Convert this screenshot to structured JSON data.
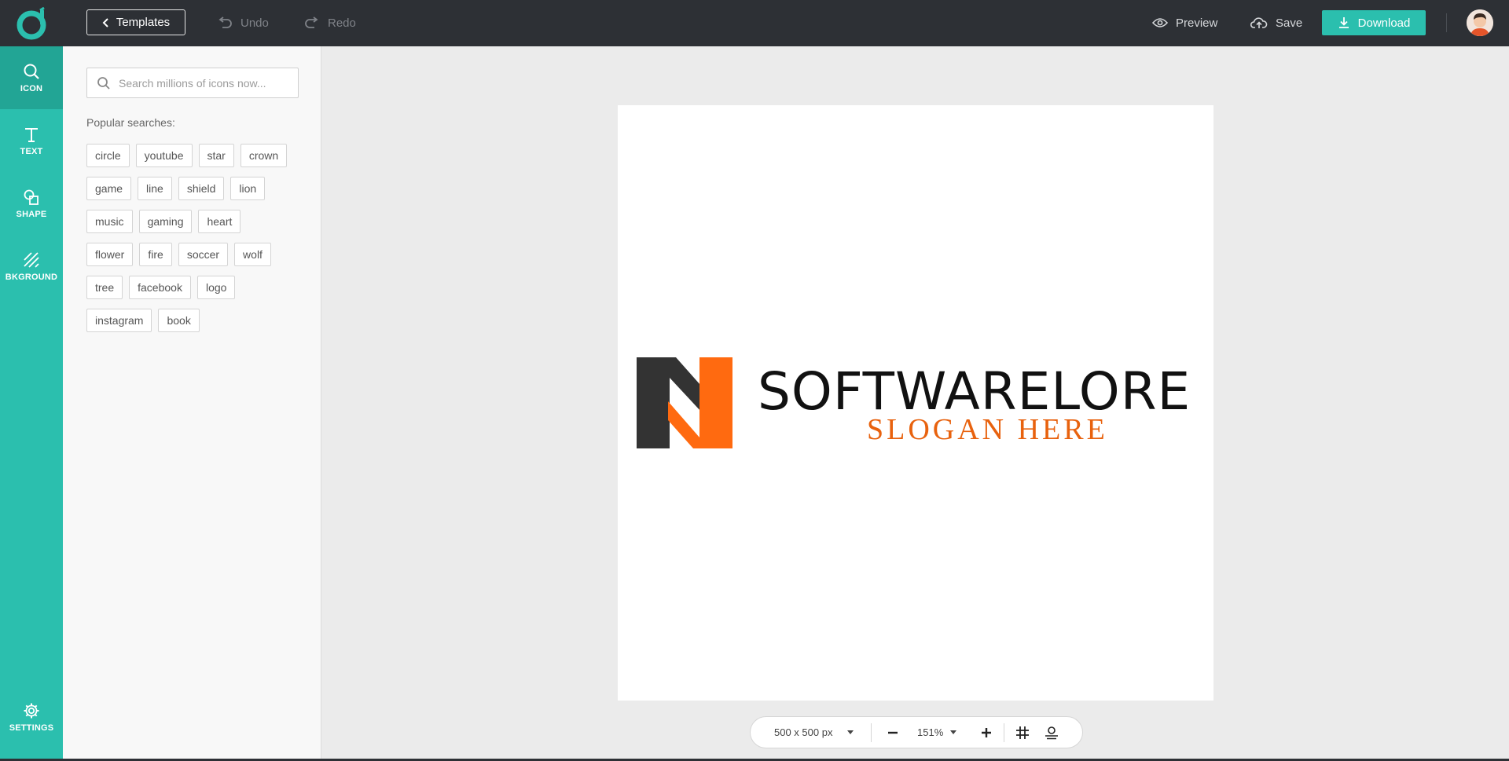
{
  "topbar": {
    "templates_label": "Templates",
    "undo_label": "Undo",
    "redo_label": "Redo",
    "preview_label": "Preview",
    "save_label": "Save",
    "download_label": "Download"
  },
  "rail": {
    "items": [
      {
        "label": "ICON",
        "icon": "search-icon"
      },
      {
        "label": "TEXT",
        "icon": "text-icon"
      },
      {
        "label": "SHAPE",
        "icon": "shape-icon"
      },
      {
        "label": "BKGROUND",
        "icon": "background-icon"
      }
    ],
    "settings_label": "SETTINGS"
  },
  "panel": {
    "search_placeholder": "Search millions of icons now...",
    "popular_title": "Popular searches:",
    "chips": [
      [
        "circle",
        "youtube",
        "star",
        "crown"
      ],
      [
        "game",
        "line",
        "shield",
        "lion"
      ],
      [
        "music",
        "gaming",
        "heart"
      ],
      [
        "flower",
        "fire",
        "soccer",
        "wolf"
      ],
      [
        "tree",
        "facebook",
        "logo"
      ],
      [
        "instagram",
        "book"
      ]
    ]
  },
  "canvas": {
    "brand_name": "SOFTWARELORE",
    "slogan": "SLOGAN HERE",
    "brand_colors": {
      "dark": "#333333",
      "accent": "#ff6a10"
    }
  },
  "bottombar": {
    "size_label": "500 x 500 px",
    "zoom_label": "151%"
  },
  "colors": {
    "topbar": "#2d3035",
    "accent": "#2bbfae",
    "rail_active": "#22a595"
  }
}
